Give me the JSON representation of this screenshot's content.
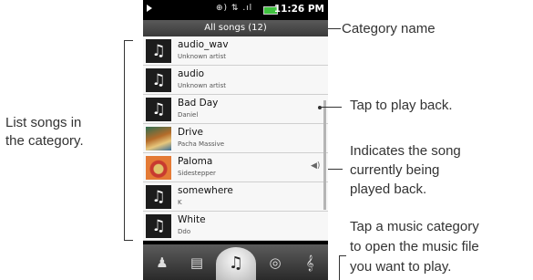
{
  "status_bar": {
    "time": "11:26 PM",
    "icons": "⊕) ⇅ .ıl"
  },
  "list": {
    "header": "All songs (12)",
    "songs": [
      {
        "title": "audio_wav",
        "artist": "Unknown artist",
        "art": "note"
      },
      {
        "title": "audio",
        "artist": "Unknown artist",
        "art": "note"
      },
      {
        "title": "Bad Day",
        "artist": "Daniel",
        "art": "note"
      },
      {
        "title": "Drive",
        "artist": "Pacha Massive",
        "art": "album"
      },
      {
        "title": "Paloma",
        "artist": "Sidestepper",
        "art": "album",
        "now_playing": true
      },
      {
        "title": "somewhere",
        "artist": "K",
        "art": "note"
      },
      {
        "title": "White",
        "artist": "Ddo",
        "art": "note"
      }
    ]
  },
  "icons": {
    "note": "♫",
    "speaker": "◀)",
    "artists": "♟",
    "albums": "▤",
    "songs": "♫",
    "playlists": "◎",
    "genres": "𝄞"
  },
  "annotations": {
    "category_name": "Category name",
    "list_songs_line1": "List songs in",
    "list_songs_line2": "the category.",
    "tap_to_play": "Tap to play back.",
    "indicates_line1": "Indicates the song",
    "indicates_line2": "currently being",
    "indicates_line3": "played back.",
    "tap_category_line1": "Tap a music category",
    "tap_category_line2": "to open the music file",
    "tap_category_line3": "you want to play."
  }
}
